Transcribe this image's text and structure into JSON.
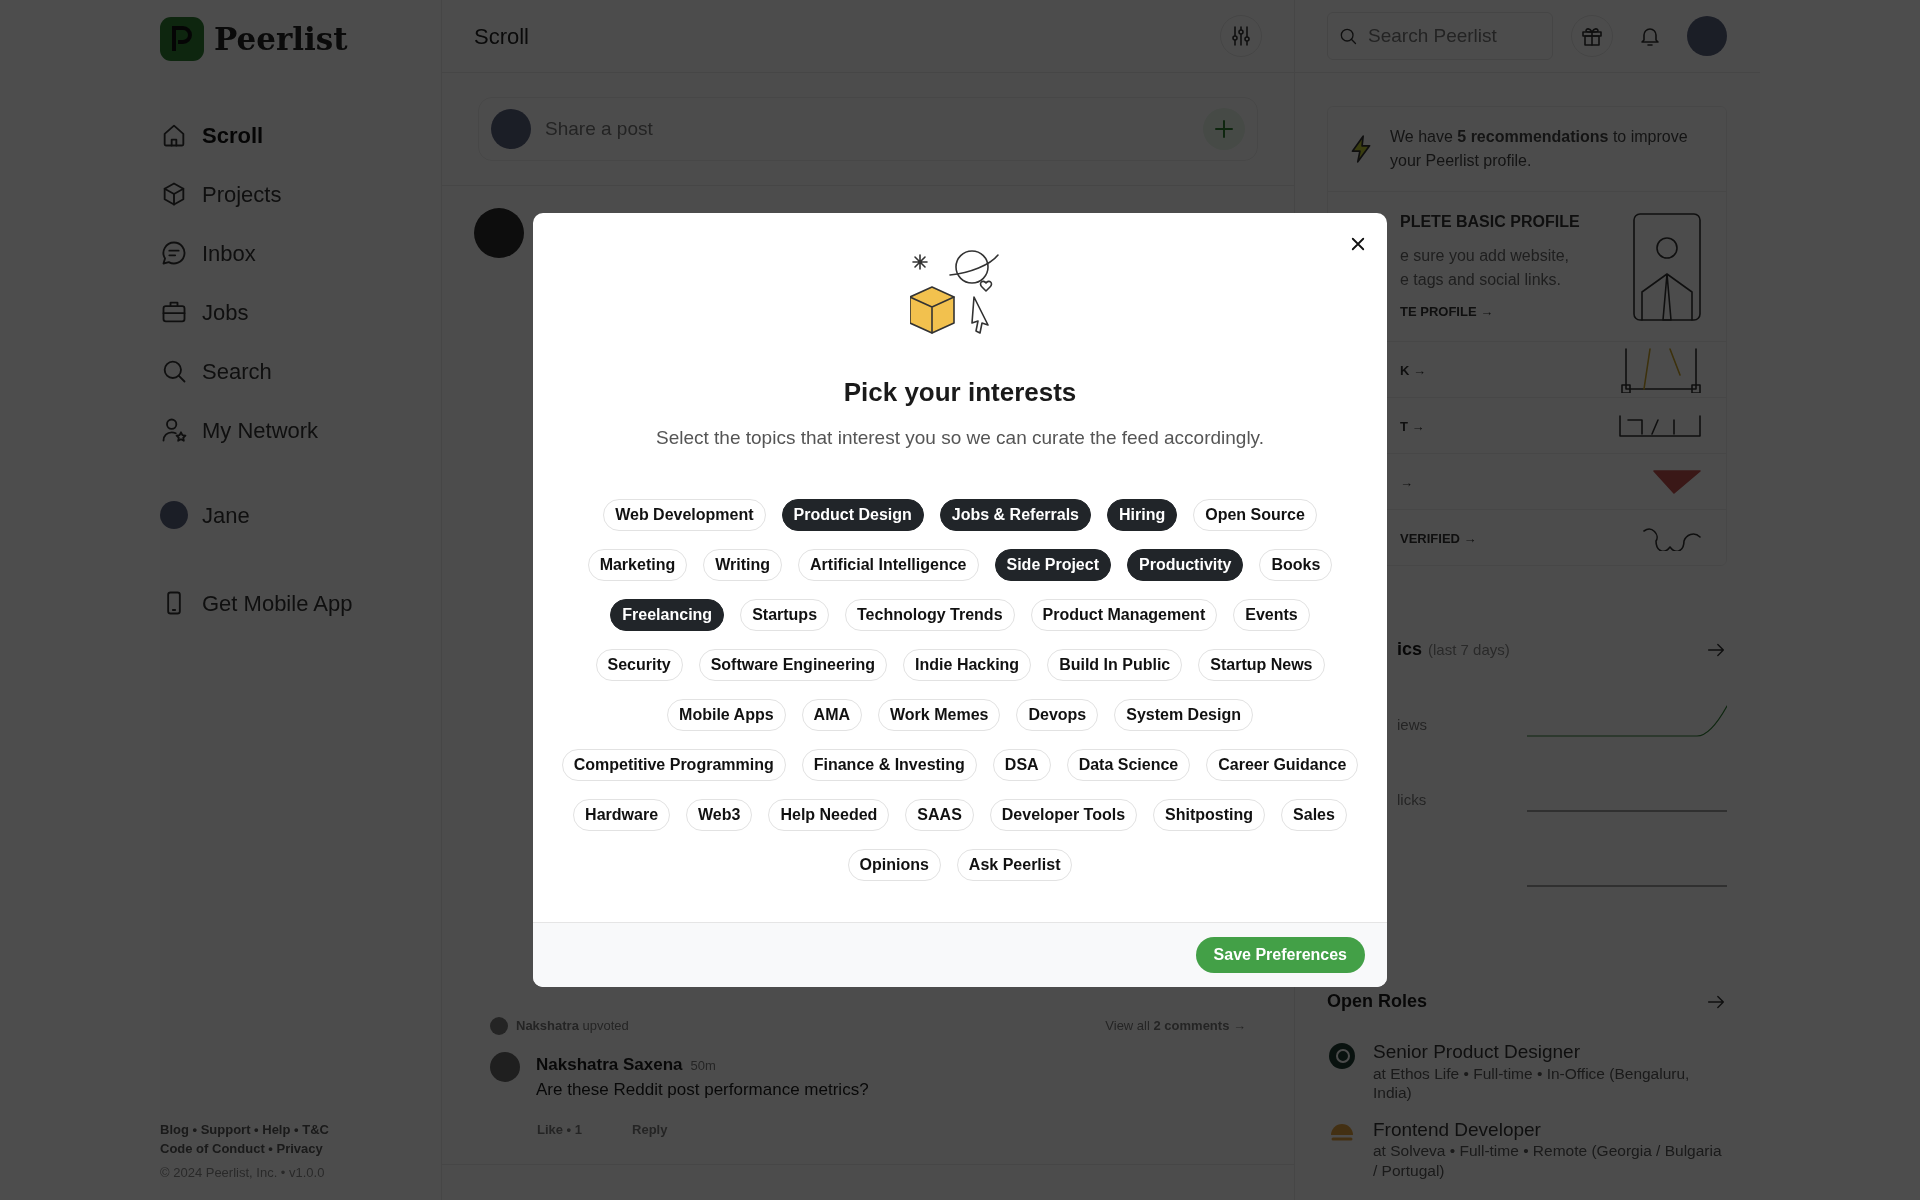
{
  "sidebar": {
    "logo": "Peerlist",
    "items": [
      {
        "label": "Scroll",
        "selected": true
      },
      {
        "label": "Projects",
        "selected": false
      },
      {
        "label": "Inbox",
        "selected": false
      },
      {
        "label": "Jobs",
        "selected": false
      },
      {
        "label": "Search",
        "selected": false
      },
      {
        "label": "My Network",
        "selected": false
      }
    ],
    "profile": {
      "name": "Jane"
    },
    "mobile_app": "Get Mobile App",
    "footer_lines": [
      "Blog • Support • Help • T&C",
      "Code of Conduct • Privacy"
    ],
    "copyright": "© 2024 Peerlist, Inc. • v1.0.0"
  },
  "header": {
    "title": "Scroll"
  },
  "composer": {
    "placeholder": "Share a post"
  },
  "post": {
    "upvote": {
      "name": "Nakshatra",
      "text": "upvoted"
    },
    "view_comments": "View all **2 comments** →",
    "comment": {
      "author": "Nakshatra Saxena",
      "time": "50m",
      "text": "Are these Reddit post performance metrics?",
      "like": "Like • 1",
      "reply": "Reply"
    }
  },
  "right": {
    "search": {
      "placeholder": "Search Peerlist"
    },
    "recommendation": "We have **5 recommendations** to improve your Peerlist profile.",
    "tasks": [
      {
        "title": "PLETE BASIC PROFILE",
        "description": [
          "e sure you add website,",
          "e tags and social links."
        ],
        "link": "TE PROFILE →"
      },
      {
        "link": "K →"
      },
      {
        "link": "T →"
      },
      {
        "link": "→"
      },
      {
        "link": "VERIFIED →"
      }
    ],
    "analytics": {
      "title": "ics",
      "period": "(last 7 days)",
      "rows": [
        {
          "label": "iews"
        },
        {
          "label": "licks"
        },
        {
          "label": ""
        }
      ]
    },
    "open_roles": {
      "title": "Open Roles",
      "roles": [
        {
          "title": "Senior Product Designer",
          "meta": "at Ethos Life • Full-time • In-Office (Bengaluru, India)"
        },
        {
          "title": "Frontend Developer",
          "meta": "at Solveva • Full-time • Remote (Georgia / Bulgaria / Portugal)"
        }
      ]
    }
  },
  "modal": {
    "title": "Pick your interests",
    "subtitle": "Select the topics that interest you so we can curate the feed accordingly.",
    "topic_rows": [
      [
        {
          "label": "Web Development",
          "selected": false
        },
        {
          "label": "Product Design",
          "selected": true
        },
        {
          "label": "Jobs & Referrals",
          "selected": true
        },
        {
          "label": "Hiring",
          "selected": true
        },
        {
          "label": "Open Source",
          "selected": false
        }
      ],
      [
        {
          "label": "Marketing",
          "selected": false
        },
        {
          "label": "Writing",
          "selected": false
        },
        {
          "label": "Artificial Intelligence",
          "selected": false
        },
        {
          "label": "Side Project",
          "selected": true
        },
        {
          "label": "Productivity",
          "selected": true
        },
        {
          "label": "Books",
          "selected": false
        }
      ],
      [
        {
          "label": "Freelancing",
          "selected": true
        },
        {
          "label": "Startups",
          "selected": false
        },
        {
          "label": "Technology Trends",
          "selected": false
        },
        {
          "label": "Product Management",
          "selected": false
        },
        {
          "label": "Events",
          "selected": false
        }
      ],
      [
        {
          "label": "Security",
          "selected": false
        },
        {
          "label": "Software Engineering",
          "selected": false
        },
        {
          "label": "Indie Hacking",
          "selected": false
        },
        {
          "label": "Build In Public",
          "selected": false
        },
        {
          "label": "Startup News",
          "selected": false
        }
      ],
      [
        {
          "label": "Mobile Apps",
          "selected": false
        },
        {
          "label": "AMA",
          "selected": false
        },
        {
          "label": "Work Memes",
          "selected": false
        },
        {
          "label": "Devops",
          "selected": false
        },
        {
          "label": "System Design",
          "selected": false
        }
      ],
      [
        {
          "label": "Competitive Programming",
          "selected": false
        },
        {
          "label": "Finance & Investing",
          "selected": false
        },
        {
          "label": "DSA",
          "selected": false
        },
        {
          "label": "Data Science",
          "selected": false
        },
        {
          "label": "Career Guidance",
          "selected": false
        }
      ],
      [
        {
          "label": "Hardware",
          "selected": false
        },
        {
          "label": "Web3",
          "selected": false
        },
        {
          "label": "Help Needed",
          "selected": false
        },
        {
          "label": "SAAS",
          "selected": false
        },
        {
          "label": "Developer Tools",
          "selected": false
        },
        {
          "label": "Shitposting",
          "selected": false
        },
        {
          "label": "Sales",
          "selected": false
        }
      ],
      [
        {
          "label": "Opinions",
          "selected": false
        },
        {
          "label": "Ask Peerlist",
          "selected": false
        }
      ]
    ],
    "save_button": "Save Preferences"
  }
}
